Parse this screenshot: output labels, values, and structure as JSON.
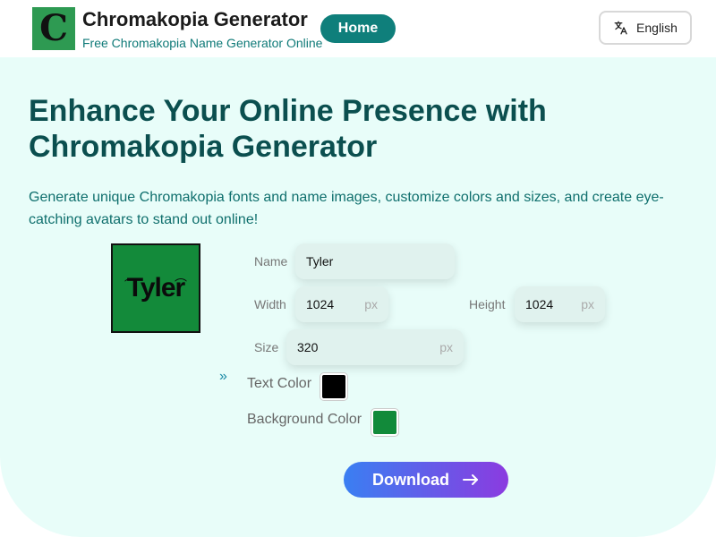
{
  "header": {
    "logo_letter": "C",
    "title": "Chromakopia Generator",
    "subtitle": "Free Chromakopia Name Generator Online",
    "home_label": "Home",
    "language_label": "English"
  },
  "hero": {
    "headline": "Enhance Your Online Presence with Chromakopia Generator",
    "description": "Generate unique Chromakopia fonts and name images, customize colors and sizes, and create eye-catching avatars to stand out online!"
  },
  "preview": {
    "text": "Tyler"
  },
  "form": {
    "name_label": "Name",
    "name_value": "Tyler",
    "width_label": "Width",
    "width_value": "1024",
    "height_label": "Height",
    "height_value": "1024",
    "size_label": "Size",
    "size_value": "320",
    "unit": "px",
    "text_color_label": "Text Color",
    "text_color": "#000000",
    "background_color_label": "Background Color",
    "background_color": "#128a3a"
  },
  "download_label": "Download",
  "colors": {
    "accent": "#0f7f7b",
    "heading": "#0b4f4f",
    "hero_bg": "#e8fdf9"
  }
}
